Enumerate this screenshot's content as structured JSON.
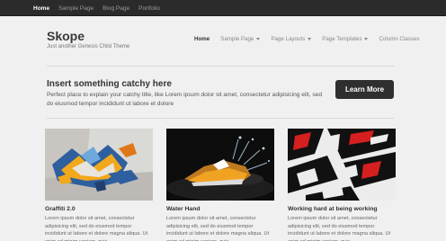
{
  "topnav": {
    "items": [
      "Home",
      "Sample Page",
      "Blog Page",
      "Portfolio"
    ]
  },
  "site": {
    "title": "Skope",
    "description": "Just another Genesis Child Theme"
  },
  "mainnav": {
    "items": [
      "Home",
      "Sample Page",
      "Page Layouts",
      "Page Templates",
      "Column Classes"
    ]
  },
  "promo": {
    "title": "Insert something catchy here",
    "text": "Perfect place to explain your catchy title, like Lorem ipsum dolor sit amet, consectetur adipisicing elit, sed do eiusmod tempor incididunt ut labore et dolore",
    "button": "Learn More"
  },
  "cards": [
    {
      "title": "Graffiti 2.0",
      "text": "Lorem ipsum dolor sit amet, consectetur adipisicing elit, sed do eiusmod tempor incididunt ut labore et dolore magna aliqua. Ut enim ad minim veniam, quis"
    },
    {
      "title": "Water Hand",
      "text": "Lorem ipsum dolor sit amet, consectetur adipisicing elit, sed do eiusmod tempor incididunt ut labore et dolore magna aliqua. Ut enim ad minim veniam, quis"
    },
    {
      "title": "Working hard at being working",
      "text": "Lorem ipsum dolor sit amet, consectetur adipisicing elit, sed do eiusmod tempor incididunt ut labore et dolore magna aliqua. Ut enim ad minim veniam, quis"
    }
  ],
  "colors": {
    "topbar": "#2b2b2b",
    "background": "#f0f0f0",
    "button": "#2f2f2f"
  }
}
